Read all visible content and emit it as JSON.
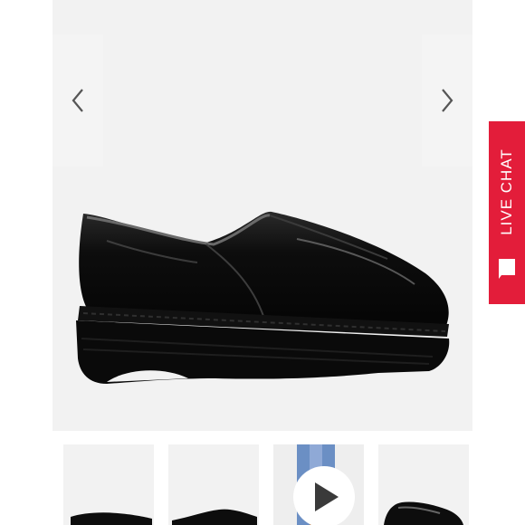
{
  "gallery": {
    "main_image_icon": "black-patent-clog-image",
    "prev_icon": "chevron-left-icon",
    "next_icon": "chevron-right-icon",
    "thumbnails": [
      {
        "icon": "clog-thumbnail"
      },
      {
        "icon": "clog-thumbnail"
      },
      {
        "icon": "video-thumbnail",
        "play_icon": "play-icon"
      },
      {
        "icon": "clog-thumbnail"
      }
    ]
  },
  "live_chat": {
    "label": "LIVE CHAT",
    "icon": "chat-bubble-icon",
    "color": "#e31d3a"
  },
  "colors": {
    "image_bg": "#f2f2f2",
    "shoe": "#0b0b0b"
  }
}
